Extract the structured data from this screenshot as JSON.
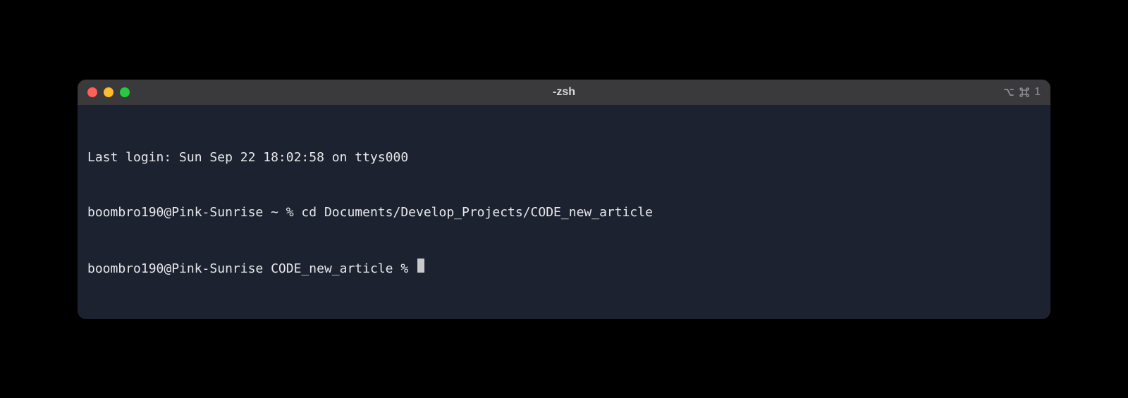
{
  "window": {
    "title": "-zsh",
    "right_badge": "1"
  },
  "terminal": {
    "lines": [
      "Last login: Sun Sep 22 18:02:58 on ttys000",
      "boombro190@Pink-Sunrise ~ % cd Documents/Develop_Projects/CODE_new_article"
    ],
    "current_prompt": "boombro190@Pink-Sunrise CODE_new_article % "
  }
}
